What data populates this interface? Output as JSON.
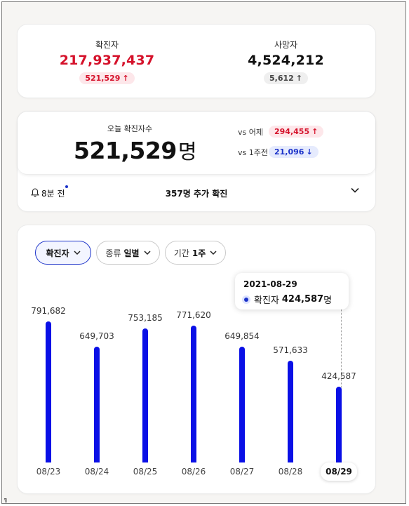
{
  "totals": {
    "confirmed_label": "확진자",
    "confirmed_value": "217,937,437",
    "confirmed_delta": "521,529",
    "deaths_label": "사망자",
    "deaths_value": "4,524,212",
    "deaths_delta": "5,612",
    "colors": {
      "confirmed": "#d5122b",
      "deaths": "#111111"
    }
  },
  "today": {
    "label": "오늘 확진자수",
    "value": "521,529",
    "unit": "명",
    "vs_yesterday_label": "vs 어제",
    "vs_yesterday_value": "294,455",
    "vs_week_label": "vs 1주전",
    "vs_week_value": "21,096"
  },
  "notice": {
    "time_text": "8분 전",
    "extra_text": "357명 추가 확진"
  },
  "filters": {
    "metric_label": "확진자",
    "kind_label": "종류",
    "kind_value": "일별",
    "period_label": "기간",
    "period_value": "1주"
  },
  "tooltip": {
    "date": "2021-08-29",
    "series_label": "확진자",
    "value": "424,587",
    "unit": "명"
  },
  "chart_data": {
    "type": "bar",
    "categories": [
      "08/23",
      "08/24",
      "08/25",
      "08/26",
      "08/27",
      "08/28",
      "08/29"
    ],
    "values": [
      791682,
      649703,
      753185,
      771620,
      649854,
      571633,
      424587
    ],
    "value_labels": [
      "791,682",
      "649,703",
      "753,185",
      "771,620",
      "649,854",
      "571,633",
      "424,587"
    ],
    "selected_index": 6,
    "ylim": [
      0,
      900000
    ],
    "bar_color": "#0a10e6"
  }
}
